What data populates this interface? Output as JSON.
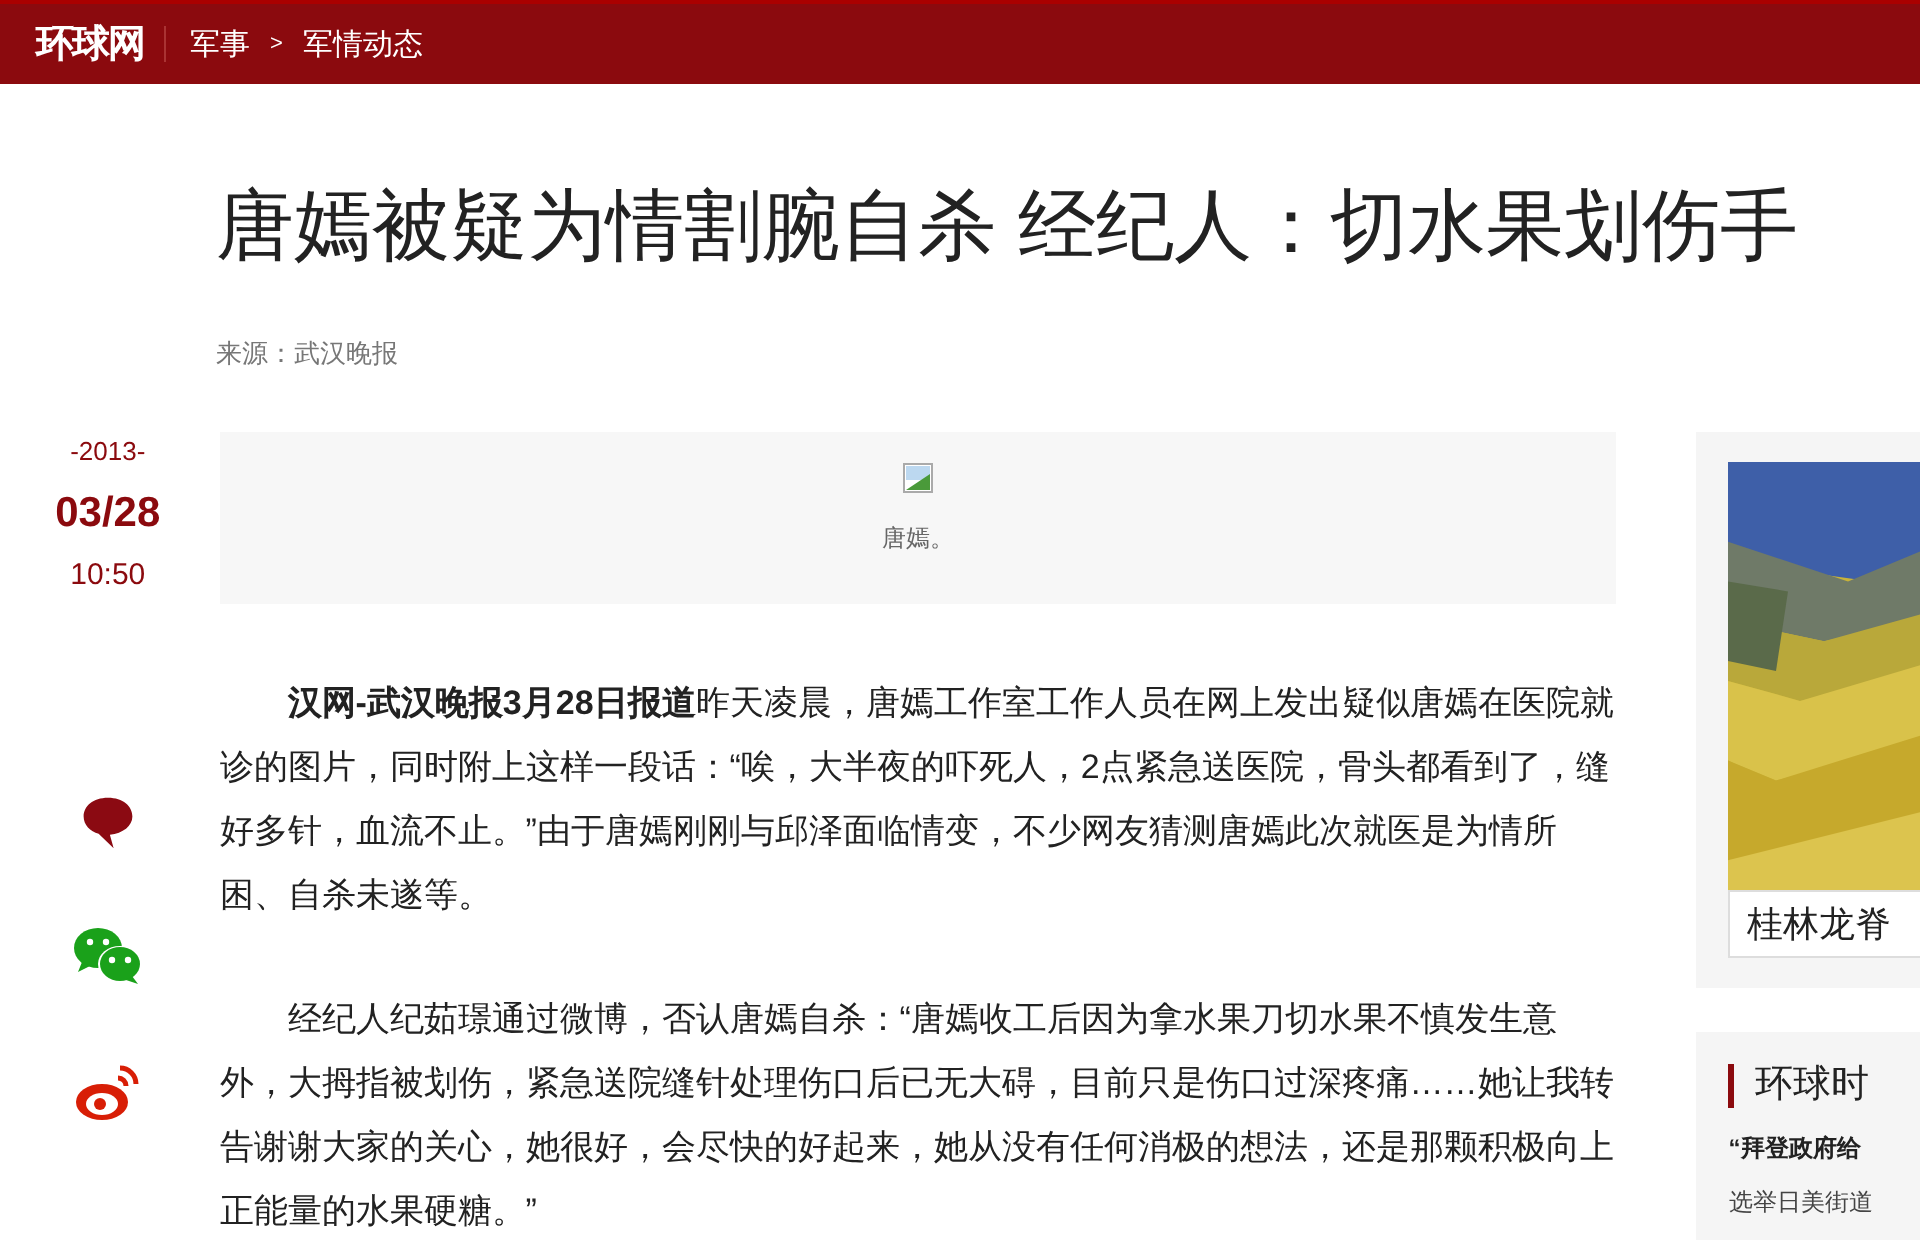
{
  "header": {
    "logo": "环球网",
    "breadcrumb": [
      {
        "label": "军事"
      },
      {
        "label": "军情动态"
      }
    ],
    "separator": ">"
  },
  "article": {
    "title": "唐嫣被疑为情割腕自杀 经纪人：切水果划伤手",
    "source": "来源：武汉晚报",
    "date": {
      "year": "-2013-",
      "day": "03/28",
      "time": "10:50"
    },
    "image_caption": "唐嫣。",
    "paragraphs": [
      "**汉网-武汉晚报3月28日报道**昨天凌晨，唐嫣工作室工作人员在网上发出疑似唐嫣在医院就诊的图片，同时附上这样一段话：“唉，大半夜的吓死人，2点紧急送医院，骨头都看到了，缝好多针，血流不止。”由于唐嫣刚刚与邱泽面临情变，不少网友猜测唐嫣此次就医是为情所困、自杀未遂等。",
      "经纪人纪茹璟通过微博，否认唐嫣自杀：“唐嫣收工后因为拿水果刀切水果不慎发生意外，大拇指被划伤，紧急送院缝针处理伤口后已无大碍，目前只是伤口过深疼痛……她让我转告谢谢大家的关心，她很好，会尽快的好起来，她从没有任何消极的想法，还是那颗积极向上正能量的水果硬糖。”"
    ]
  },
  "share": [
    {
      "kind": "comment"
    },
    {
      "kind": "wechat"
    },
    {
      "kind": "weibo"
    }
  ],
  "sidebar": {
    "photo_caption": "桂林龙脊",
    "section_title": "环球时",
    "headline": "“拜登政府给",
    "item": "选举日美街道"
  }
}
